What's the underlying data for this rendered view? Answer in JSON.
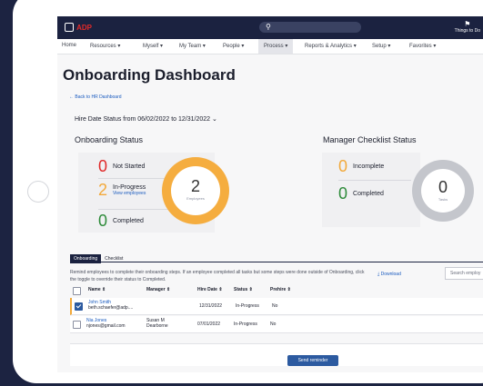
{
  "header": {
    "logo_text": "ADP",
    "todo_label": "Things to Do"
  },
  "nav": {
    "items": [
      {
        "label": "Home"
      },
      {
        "label": "Resources ▾"
      },
      {
        "label": "Myself ▾"
      },
      {
        "label": "My Team ▾"
      },
      {
        "label": "People ▾"
      },
      {
        "label": "Process ▾"
      },
      {
        "label": "Reports & Analytics ▾"
      },
      {
        "label": "Setup ▾"
      },
      {
        "label": "Favorites ▾"
      }
    ]
  },
  "page": {
    "title": "Onboarding Dashboard",
    "back_link": "← Back to HR Dashboard",
    "hire_date": "Hire Date Status from 06/02/2022 to 12/31/2022 ⌄"
  },
  "onboarding_status": {
    "title": "Onboarding Status",
    "not_started": {
      "count": "0",
      "label": "Not Started"
    },
    "in_progress": {
      "count": "2",
      "label": "In-Progress",
      "link": "View employees"
    },
    "completed": {
      "count": "0",
      "label": "Completed"
    },
    "donut": {
      "value": "2",
      "caption": "Employees"
    }
  },
  "manager_checklist": {
    "title": "Manager Checklist Status",
    "incomplete": {
      "count": "0",
      "label": "Incomplete"
    },
    "completed": {
      "count": "0",
      "label": "Completed"
    },
    "donut": {
      "value": "0",
      "caption": "Tasks"
    }
  },
  "tabs": [
    {
      "label": "Onboarding"
    },
    {
      "label": "Checklist"
    }
  ],
  "remind_text": "Remind employees to complete their onboarding steps. If an employee completed all tasks but some steps were done outside of Onboarding, click the toggle to override their status to Completed.",
  "download_label": "Download",
  "search_placeholder": "Search employ",
  "table": {
    "headers": [
      "Name ⇕",
      "Manager ⇕",
      "Hire Date ⇕",
      "Status ⇕",
      "Prehire ⇕"
    ],
    "rows": [
      {
        "name": "John Smith",
        "email": "beth.schaefer@adp....",
        "manager": "",
        "hire_date": "12/31/2022",
        "status": "In-Progress",
        "prehire": "No"
      },
      {
        "name": "Nia Jones",
        "email": "njones@gmail.com",
        "manager": "Susan M Dearborne",
        "hire_date": "07/01/2022",
        "status": "In-Progress",
        "prehire": "No"
      }
    ]
  },
  "send_reminder_label": "Send reminder",
  "colors": {
    "accent_red": "#e02a2a",
    "accent_orange": "#f2a93b",
    "accent_green": "#2e8b3a",
    "nav_dark": "#1b2240",
    "link_blue": "#1a5bbf"
  }
}
